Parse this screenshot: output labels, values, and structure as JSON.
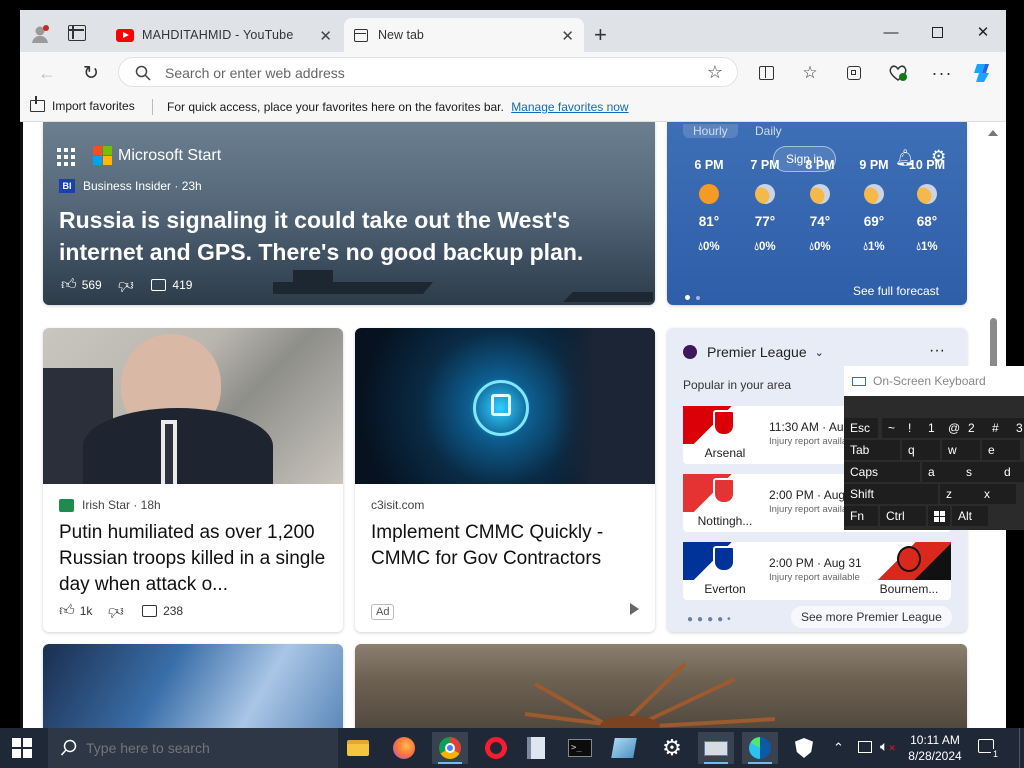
{
  "browser": {
    "tabs": [
      {
        "label": "MAHDITAHMID - YouTube",
        "active": false
      },
      {
        "label": "New tab",
        "active": true
      }
    ],
    "address_placeholder": "Search or enter web address",
    "favorites_bar": {
      "import_label": "Import favorites",
      "message": "For quick access, place your favorites here on the favorites bar.",
      "manage_link": "Manage favorites now"
    }
  },
  "start": {
    "brand": "Microsoft Start",
    "hero": {
      "source_badge": "BI",
      "source": "Business Insider · 23h",
      "headline": "Russia is signaling it could take out the West's internet and GPS. There's no good backup plan.",
      "likes": "569",
      "comments": "419"
    },
    "sign_in": "Sign in",
    "weather": {
      "tabs": [
        "Hourly",
        "Daily"
      ],
      "hours": [
        {
          "time": "6 PM",
          "icon": "sun-icon",
          "temp": "81°",
          "precip": "0%"
        },
        {
          "time": "7 PM",
          "icon": "partly-cloudy-night-icon",
          "temp": "77°",
          "precip": "0%"
        },
        {
          "time": "8 PM",
          "icon": "partly-cloudy-night-icon",
          "temp": "74°",
          "precip": "0%"
        },
        {
          "time": "9 PM",
          "icon": "partly-cloudy-night-icon",
          "temp": "69°",
          "precip": "1%"
        },
        {
          "time": "10 PM",
          "icon": "partly-cloudy-night-icon",
          "temp": "68°",
          "precip": "1%"
        }
      ],
      "forecast_link": "See full forecast"
    },
    "articles": [
      {
        "source_badge": "IS",
        "source": "Irish Star · 18h",
        "headline": "Putin humiliated as over 1,200 Russian troops killed in a single day when attack o...",
        "likes": "1k",
        "comments": "238"
      },
      {
        "source": "c3isit.com",
        "headline": "Implement CMMC Quickly - CMMC for Gov Contractors",
        "badge": "Ad"
      }
    ],
    "premier_league": {
      "title": "Premier League",
      "subtitle": "Popular in your area",
      "matches": [
        {
          "home": "Arsenal",
          "time": "11:30 AM · Aug",
          "note": "Injury report availa",
          "color": "#db0007"
        },
        {
          "home": "Nottingh...",
          "time": "2:00 PM · Aug",
          "note": "Injury report availa",
          "color": "#e53233"
        },
        {
          "home": "Everton",
          "time": "2:00 PM · Aug 31",
          "note": "Injury report available",
          "away": "Bournem...",
          "color": "#003399",
          "away_color": "#da291c"
        }
      ],
      "more_link": "See more Premier League"
    }
  },
  "osk": {
    "title": "On-Screen Keyboard",
    "rows": [
      [
        "Esc",
        "~",
        "!",
        "1",
        "@",
        "2",
        "#",
        "3"
      ],
      [
        "Tab",
        "q",
        "w",
        "e"
      ],
      [
        "Caps",
        "a",
        "s",
        "d"
      ],
      [
        "Shift",
        "z",
        "x"
      ],
      [
        "Fn",
        "Ctrl",
        "Alt"
      ]
    ]
  },
  "taskbar": {
    "search_placeholder": "Type here to search",
    "time": "10:11 AM",
    "date": "8/28/2024",
    "notification_count": "1"
  }
}
